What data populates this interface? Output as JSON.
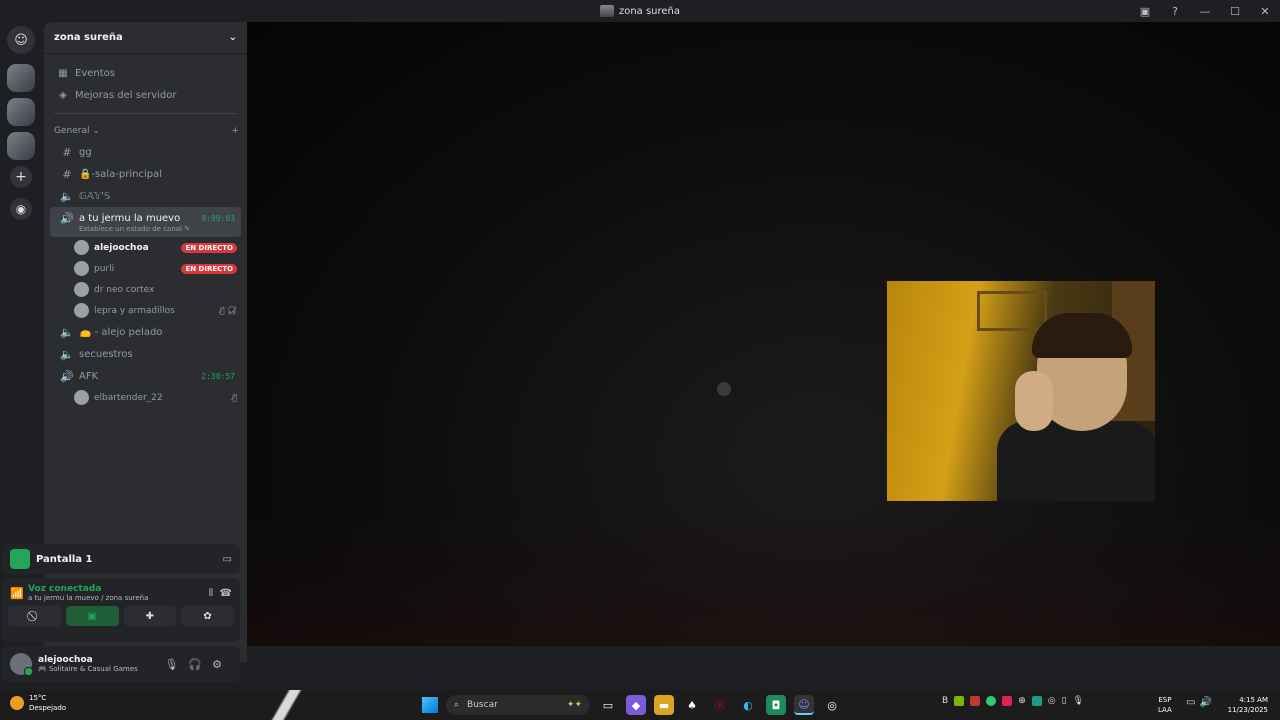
{
  "window": {
    "title": "zona sureña",
    "controls": [
      "▣",
      "?",
      "—",
      "☐",
      "✕"
    ]
  },
  "server": {
    "name": "zona sureña"
  },
  "nav": [
    {
      "label": "Eventos",
      "icon": "calendar-icon",
      "glyph": "▦"
    },
    {
      "label": "Mejoras del servidor",
      "icon": "boost-icon",
      "glyph": "◈"
    }
  ],
  "category": {
    "label": "General ⌄",
    "add": "+"
  },
  "channels": {
    "gg": {
      "label": "gg"
    },
    "sala": {
      "label": "🔒-sala-principal"
    },
    "gays": {
      "label": "𝔾𝔸𝕐'𝕊"
    },
    "active": {
      "label": "a tu jermu la muevo",
      "timer": "9:09:03",
      "status": "Establece un estado de canal ✎"
    },
    "alejo": {
      "label": "👝 - alejo pelado"
    },
    "secuestros": {
      "label": "secuestros"
    },
    "afk": {
      "label": "AFK",
      "timer": "2:30:57"
    }
  },
  "voice_users": [
    {
      "name": "alejoochoa",
      "live": "EN DIRECTO"
    },
    {
      "name": "purli",
      "live": "EN DIRECTO"
    },
    {
      "name": "dr neo cortex"
    },
    {
      "name": "lepra y armadillos",
      "icons": "🎙̸ 🎧̸"
    }
  ],
  "afk_user": {
    "name": "elbartender_22",
    "icons": "🎙̸"
  },
  "screen_share": {
    "label": "Pantalla 1"
  },
  "voice": {
    "status": "Voz conectada",
    "location": "a tu jermu la muevo / zona sureña"
  },
  "account": {
    "name": "alejoochoa",
    "activity": "🎮 Solitaire & Casual Games"
  },
  "taskbar": {
    "temp": "15°C",
    "weather": "Despejado",
    "search_placeholder": "Buscar",
    "lang1": "ESP",
    "lang2": "LAA",
    "time": "4:15 AM",
    "date": "11/23/2025"
  }
}
